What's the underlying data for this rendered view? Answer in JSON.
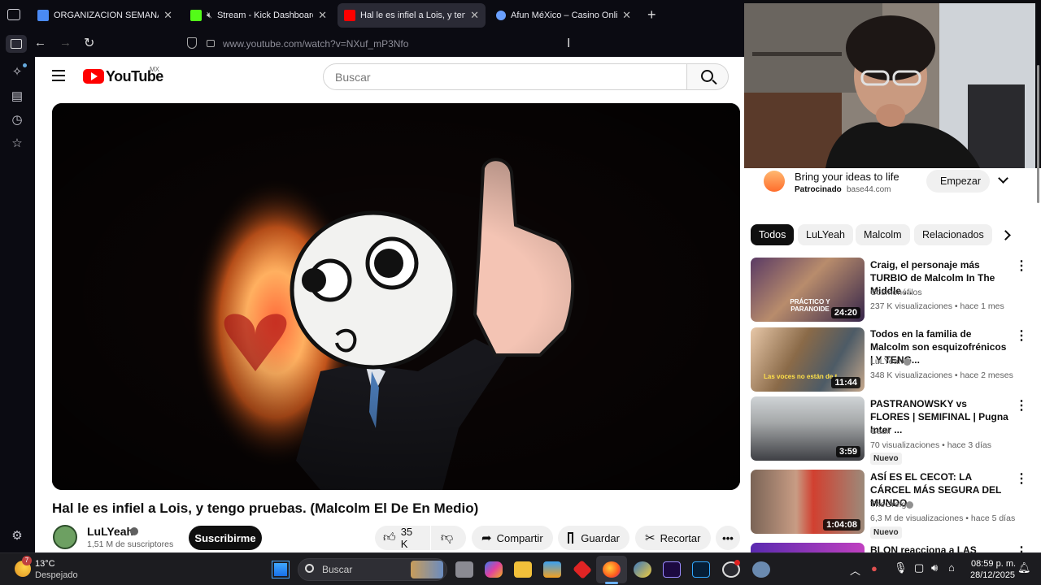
{
  "browser": {
    "tabs": [
      {
        "title": "ORGANIZACION SEMANAL - D",
        "color": "#4a8af4"
      },
      {
        "title": "Stream - Kick Dashboard",
        "color": "#53fc18"
      },
      {
        "title": "Hal le es infiel a Lois, y tengo pr",
        "color": "#ff0000"
      },
      {
        "title": "Afun MéXico – Casino Online Y",
        "color": "#6aa0ff"
      }
    ],
    "url": "www.youtube.com/watch?v=NXuf_mP3Nfo"
  },
  "youtube": {
    "logo_text": "YouTube",
    "region": "MX",
    "search_placeholder": "Buscar",
    "video_title": "Hal le es infiel a Lois, y tengo pruebas. (Malcolm El De En Medio)",
    "channel": {
      "name": "LuLYeah",
      "subscribers": "1,51 M de suscriptores",
      "subscribe_label": "Suscribirme"
    },
    "actions": {
      "likes": "35 K",
      "share": "Compartir",
      "save": "Guardar",
      "clip": "Recortar"
    },
    "ad": {
      "title": "Bring your ideas to life",
      "sponsored": "Patrocinado",
      "domain": "base44.com",
      "cta": "Empezar"
    },
    "chips": [
      "Todos",
      "LuLYeah",
      "Malcolm",
      "Relacionados"
    ],
    "related": [
      {
        "title": "Craig, el personaje más TURBIO de Malcolm In The Middle ...",
        "channel": "Cosmonéfilos",
        "meta": "237 K visualizaciones • hace 1 mes",
        "duration": "24:20",
        "thumb_text": "PRÁCTICO Y PARANOIDE",
        "badge": ""
      },
      {
        "title": "Todos en la familia de Malcolm son esquizofrénicos | Y TENG...",
        "channel": "LuLYeah",
        "meta": "348 K visualizaciones • hace 2 meses",
        "duration": "11:44",
        "thumb_text": "Las voces no están de t",
        "badge": ""
      },
      {
        "title": "PASTRANOWSKY vs FLORES | SEMIFINAL | Pugna Inter ...",
        "channel": "Gadir",
        "meta": "70 visualizaciones • hace 3 días",
        "duration": "3:59",
        "thumb_text": "",
        "badge": "Nuevo"
      },
      {
        "title": "ASÍ ES EL CECOT: LA CÁRCEL MÁS SEGURA DEL MUNDO",
        "channel": "TheGrefg",
        "meta": "6,3 M de visualizaciones • hace 5 días",
        "duration": "1:04:08",
        "thumb_text": "",
        "badge": "Nuevo"
      },
      {
        "title": "BLON reacciona a LAS",
        "channel": "",
        "meta": "",
        "duration": "",
        "thumb_text": "",
        "badge": ""
      }
    ]
  },
  "taskbar": {
    "weather_temp": "13°C",
    "weather_desc": "Despejado",
    "weather_badge": "7",
    "search_placeholder": "Buscar",
    "time": "08:59 p. m.",
    "date": "28/12/2025"
  }
}
